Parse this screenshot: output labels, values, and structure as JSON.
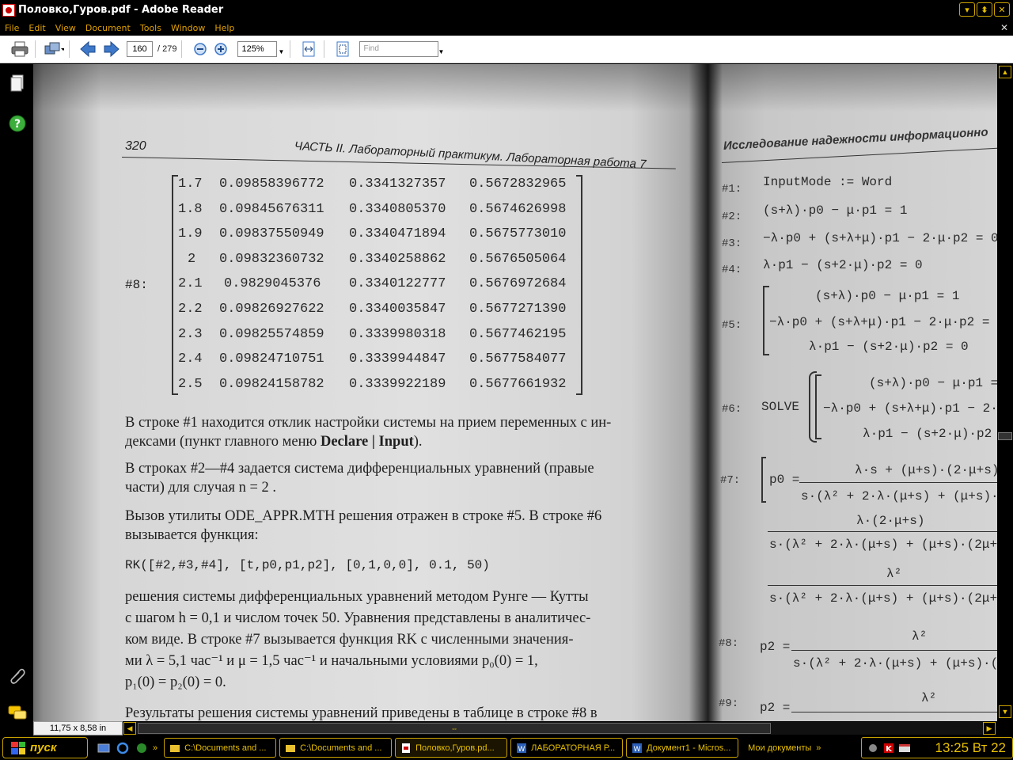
{
  "window": {
    "title": "Половко,Гуров.pdf - Adobe Reader"
  },
  "window_buttons": [
    "minimize",
    "restore",
    "close"
  ],
  "menu": [
    "File",
    "Edit",
    "View",
    "Document",
    "Tools",
    "Window",
    "Help"
  ],
  "toolbar": {
    "page_current": "160",
    "page_total": "/ 279",
    "zoom": "125%",
    "find_placeholder": "Find"
  },
  "status": {
    "page_size": "11,75 x 8,58 in"
  },
  "left_page": {
    "page_number": "320",
    "header": "ЧАСТЬ II. Лабораторный практикум.   Лабораторная работа 7",
    "row_label": "#8:",
    "matrix": [
      [
        "1.7",
        "0.09858396772",
        "0.3341327357",
        "0.5672832965"
      ],
      [
        "1.8",
        "0.09845676311",
        "0.3340805370",
        "0.5674626998"
      ],
      [
        "1.9",
        "0.09837550949",
        "0.3340471894",
        "0.5675773010"
      ],
      [
        "2",
        "0.09832360732",
        "0.3340258862",
        "0.5676505064"
      ],
      [
        "2.1",
        "0.9829045376",
        "0.3340122777",
        "0.5676972684"
      ],
      [
        "2.2",
        "0.09826927622",
        "0.3340035847",
        "0.5677271390"
      ],
      [
        "2.3",
        "0.09825574859",
        "0.3339980318",
        "0.5677462195"
      ],
      [
        "2.4",
        "0.09824710751",
        "0.3339944847",
        "0.5677584077"
      ],
      [
        "2.5",
        "0.09824158782",
        "0.3339922189",
        "0.5677661932"
      ]
    ],
    "para1_line1": "В строке #1 находится отклик настройки системы на прием переменных с ин-",
    "para1_line2a": "дексами (пункт главного меню ",
    "para1_line2b": "Declare | Input",
    "para1_line2c": ").",
    "para2_line1": "В строках #2—#4 задается система дифференциальных уравнений (правые",
    "para2_line2": "части) для случая  n = 2 .",
    "para3_line1": "Вызов утилиты ODE_APPR.MTH решения отражен в строке #5. В строке #6",
    "para3_line2": "вызывается функция:",
    "code": "RK([#2,#3,#4], [t,p0,p1,p2], [0,1,0,0], 0.1, 50)",
    "para4_line1": "решения системы дифференциальных уравнений методом Рунге — Кутты",
    "para4_line2": "с шагом  h = 0,1  и числом точек 50. Уравнения представлены в аналитичес-",
    "para4_line3": "ком виде. В строке #7 вызывается функция RK с численными значения-",
    "para4_line4": "ми   λ = 5,1 час⁻¹   и   μ = 1,5 час⁻¹   и   начальными   условиями   p₀(0) = 1,",
    "para4_line5": "p₁(0) = p₂(0) = 0.",
    "para5_line1": "Результаты решения системы уравнений приведены в таблице в строке #8 в"
  },
  "right_page": {
    "header": "Исследование надежности информационно",
    "lines": [
      {
        "label": "#1:",
        "text": "InputMode := Word"
      },
      {
        "label": "#2:",
        "text": "(s+λ)·p0 − μ·p1 = 1"
      },
      {
        "label": "#3:",
        "text": "−λ·p0 + (s+λ+μ)·p1 − 2·μ·p2 = 0"
      },
      {
        "label": "#4:",
        "text": "λ·p1 − (s+2·μ)·p2 = 0"
      }
    ],
    "row5_label": "#5:",
    "row5": [
      "(s+λ)·p0 − μ·p1 = 1",
      "−λ·p0 + (s+λ+μ)·p1 − 2·μ·p2 = (",
      "λ·p1 − (s+2·μ)·p2 = 0"
    ],
    "row6_label": "#6:",
    "row6_solve": "SOLVE",
    "row6": [
      "(s+λ)·p0 − μ·p1 =",
      "−λ·p0 + (s+λ+μ)·p1 − 2·",
      "λ·p1 − (s+2·μ)·p2"
    ],
    "row7_label": "#7:",
    "row7_lhs": "p0 =",
    "row7_num": "λ·s + (μ+s)·(2·μ+s)",
    "row7_den": "s·(λ² + 2·λ·(μ+s) + (μ+s)·(2",
    "row7b_num": "λ·(2·μ+s)",
    "row7b_den": "s·(λ² + 2·λ·(μ+s) + (μ+s)·(2μ+s",
    "row7c_num": "λ²",
    "row7c_den": "s·(λ² + 2·λ·(μ+s) + (μ+s)·(2μ+s",
    "row8_label": "#8:",
    "row8_lhs": "p2 =",
    "row8_num": "λ²",
    "row8_den": "s·(λ² + 2·λ·(μ+s) + (μ+s)·(2·",
    "row9_label": "#9:",
    "row9_lhs": "p2 =",
    "row9_num": "λ²"
  },
  "taskbar": {
    "start": "пуск",
    "tasks": [
      "C:\\Documents and ...",
      "C:\\Documents and ...",
      "Половко,Гуров.pd...",
      "ЛАБОРАТОРНАЯ Р...",
      "Документ1 - Micros..."
    ],
    "tray_label": "Мои документы",
    "clock": "13:25 Вт 22"
  }
}
